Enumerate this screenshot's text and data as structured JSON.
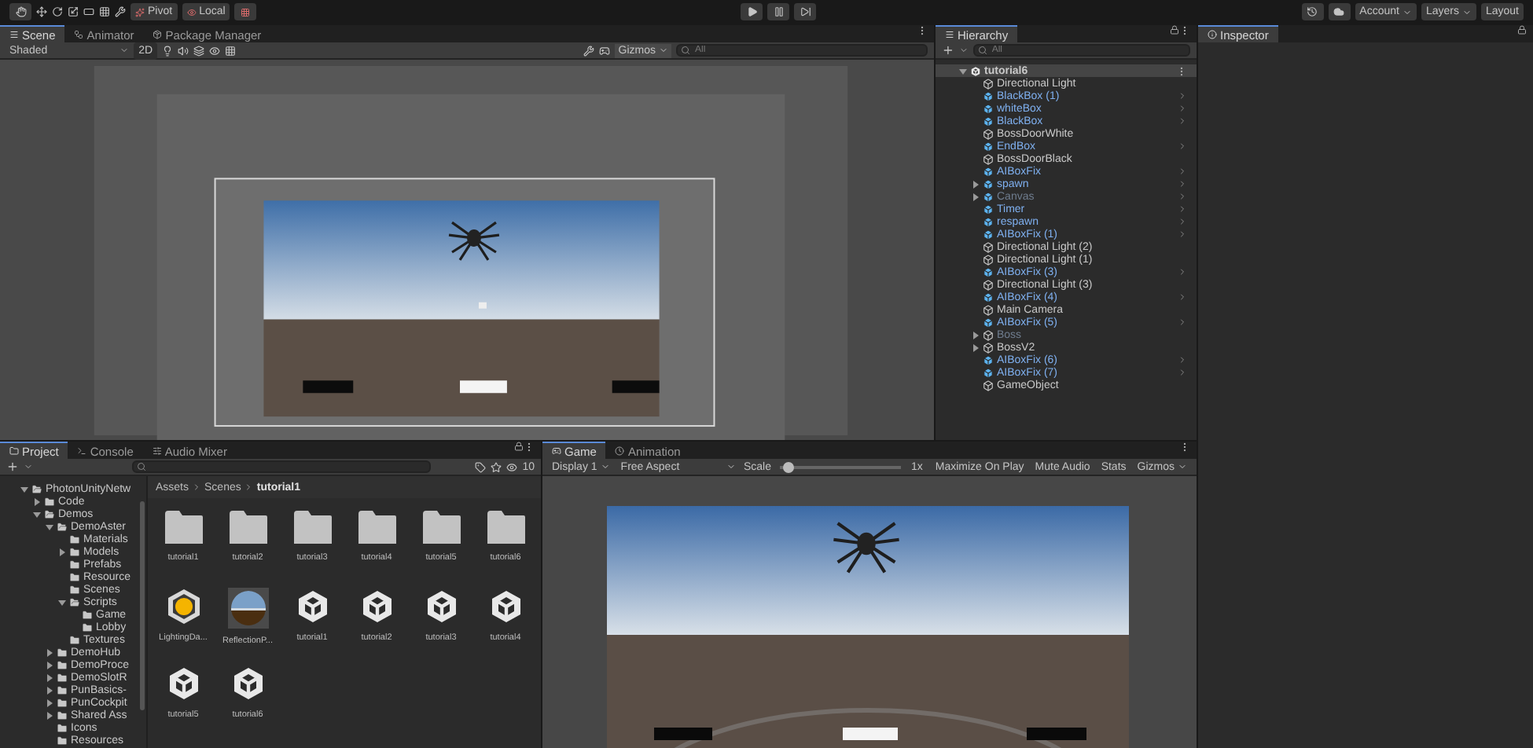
{
  "toolbar": {
    "pivot": "Pivot",
    "local": "Local",
    "account": "Account",
    "layers": "Layers",
    "layout": "Layout"
  },
  "scene_panel": {
    "tabs": [
      {
        "label": "Scene",
        "kind": "scene",
        "selected": true
      },
      {
        "label": "Animator",
        "kind": "animator",
        "selected": false
      },
      {
        "label": "Package Manager",
        "kind": "package",
        "selected": false
      }
    ],
    "shading": "Shaded",
    "mode_2d": "2D",
    "gizmos": "Gizmos",
    "search": {
      "placeholder": "All"
    }
  },
  "hierarchy": {
    "tab": {
      "label": "Hierarchy",
      "kind": "hierarchy",
      "selected": true
    },
    "search": {
      "placeholder": "All"
    },
    "items": [
      {
        "name": "tutorial6",
        "kind": "scene",
        "expanded": true,
        "disabled": false,
        "children": [
          {
            "name": "Directional Light",
            "kind": "object",
            "disabled": false
          },
          {
            "name": "BlackBox (1)",
            "kind": "prefab",
            "disabled": false
          },
          {
            "name": "whiteBox",
            "kind": "prefab",
            "disabled": false
          },
          {
            "name": "BlackBox",
            "kind": "prefab",
            "disabled": false
          },
          {
            "name": "BossDoorWhite",
            "kind": "object",
            "disabled": false
          },
          {
            "name": "EndBox",
            "kind": "prefab",
            "disabled": false
          },
          {
            "name": "BossDoorBlack",
            "kind": "object",
            "disabled": false
          },
          {
            "name": "AIBoxFix",
            "kind": "prefab",
            "disabled": false
          },
          {
            "name": "spawn",
            "kind": "prefab",
            "expanded": false,
            "disabled": false
          },
          {
            "name": "Canvas",
            "kind": "prefab",
            "expanded": false,
            "disabled": true
          },
          {
            "name": "Timer",
            "kind": "prefab",
            "disabled": false
          },
          {
            "name": "respawn",
            "kind": "prefab",
            "disabled": false
          },
          {
            "name": "AIBoxFix (1)",
            "kind": "prefab",
            "disabled": false
          },
          {
            "name": "Directional Light (2)",
            "kind": "object",
            "disabled": false
          },
          {
            "name": "Directional Light (1)",
            "kind": "object",
            "disabled": false
          },
          {
            "name": "AIBoxFix (3)",
            "kind": "prefab",
            "disabled": false
          },
          {
            "name": "Directional Light (3)",
            "kind": "object",
            "disabled": false
          },
          {
            "name": "AIBoxFix (4)",
            "kind": "prefab",
            "disabled": false
          },
          {
            "name": "Main Camera",
            "kind": "object",
            "disabled": false
          },
          {
            "name": "AIBoxFix (5)",
            "kind": "prefab",
            "disabled": false
          },
          {
            "name": "Boss",
            "kind": "object",
            "expanded": false,
            "disabled": true
          },
          {
            "name": "BossV2",
            "kind": "object",
            "expanded": false,
            "disabled": false
          },
          {
            "name": "AIBoxFix (6)",
            "kind": "prefab",
            "disabled": false
          },
          {
            "name": "AIBoxFix (7)",
            "kind": "prefab",
            "disabled": false
          },
          {
            "name": "GameObject",
            "kind": "object",
            "disabled": false
          }
        ]
      }
    ]
  },
  "inspector": {
    "tab": {
      "label": "Inspector",
      "kind": "inspector",
      "selected": true
    }
  },
  "project": {
    "tabs": [
      {
        "label": "Project",
        "kind": "project",
        "selected": true
      },
      {
        "label": "Console",
        "kind": "console",
        "selected": false
      },
      {
        "label": "Audio Mixer",
        "kind": "mixer",
        "selected": false
      }
    ],
    "count": "10",
    "breadcrumb": [
      "Assets",
      "Scenes",
      "tutorial1"
    ],
    "tree": [
      {
        "name": "PhotonUnityNetw",
        "expanded": true,
        "children": [
          {
            "name": "Code",
            "expanded": false
          },
          {
            "name": "Demos",
            "expanded": true,
            "children": [
              {
                "name": "DemoAster",
                "expanded": true,
                "children": [
                  {
                    "name": "Materials"
                  },
                  {
                    "name": "Models",
                    "expanded": false
                  },
                  {
                    "name": "Prefabs"
                  },
                  {
                    "name": "Resource"
                  },
                  {
                    "name": "Scenes"
                  },
                  {
                    "name": "Scripts",
                    "expanded": true,
                    "children": [
                      {
                        "name": "Game"
                      },
                      {
                        "name": "Lobby"
                      }
                    ]
                  },
                  {
                    "name": "Textures"
                  }
                ]
              },
              {
                "name": "DemoHub",
                "expanded": false
              },
              {
                "name": "DemoProce",
                "expanded": false
              },
              {
                "name": "DemoSlotR",
                "expanded": false
              },
              {
                "name": "PunBasics-",
                "expanded": false
              },
              {
                "name": "PunCockpit",
                "expanded": false
              },
              {
                "name": "Shared Ass",
                "expanded": false
              },
              {
                "name": "Icons"
              },
              {
                "name": "Resources"
              }
            ]
          }
        ]
      }
    ],
    "assets": [
      {
        "name": "tutorial1",
        "kind": "folder"
      },
      {
        "name": "tutorial2",
        "kind": "folder"
      },
      {
        "name": "tutorial3",
        "kind": "folder"
      },
      {
        "name": "tutorial4",
        "kind": "folder"
      },
      {
        "name": "tutorial5",
        "kind": "folder"
      },
      {
        "name": "tutorial6",
        "kind": "folder"
      },
      {
        "name": "LightingDa...",
        "kind": "lighting"
      },
      {
        "name": "ReflectionP...",
        "kind": "reflection"
      },
      {
        "name": "tutorial1",
        "kind": "scene"
      },
      {
        "name": "tutorial2",
        "kind": "scene"
      },
      {
        "name": "tutorial3",
        "kind": "scene"
      },
      {
        "name": "tutorial4",
        "kind": "scene"
      },
      {
        "name": "tutorial5",
        "kind": "scene"
      },
      {
        "name": "tutorial6",
        "kind": "scene"
      }
    ]
  },
  "game": {
    "tabs": [
      {
        "label": "Game",
        "kind": "game",
        "selected": true
      },
      {
        "label": "Animation",
        "kind": "animation",
        "selected": false
      }
    ],
    "display": "Display 1",
    "aspect": "Free Aspect",
    "scale_label": "Scale",
    "scale": {
      "level": 0.02
    },
    "scale_value": "1x",
    "buttons": [
      "Maximize On Play",
      "Mute Audio",
      "Stats"
    ],
    "gizmos": "Gizmos"
  }
}
